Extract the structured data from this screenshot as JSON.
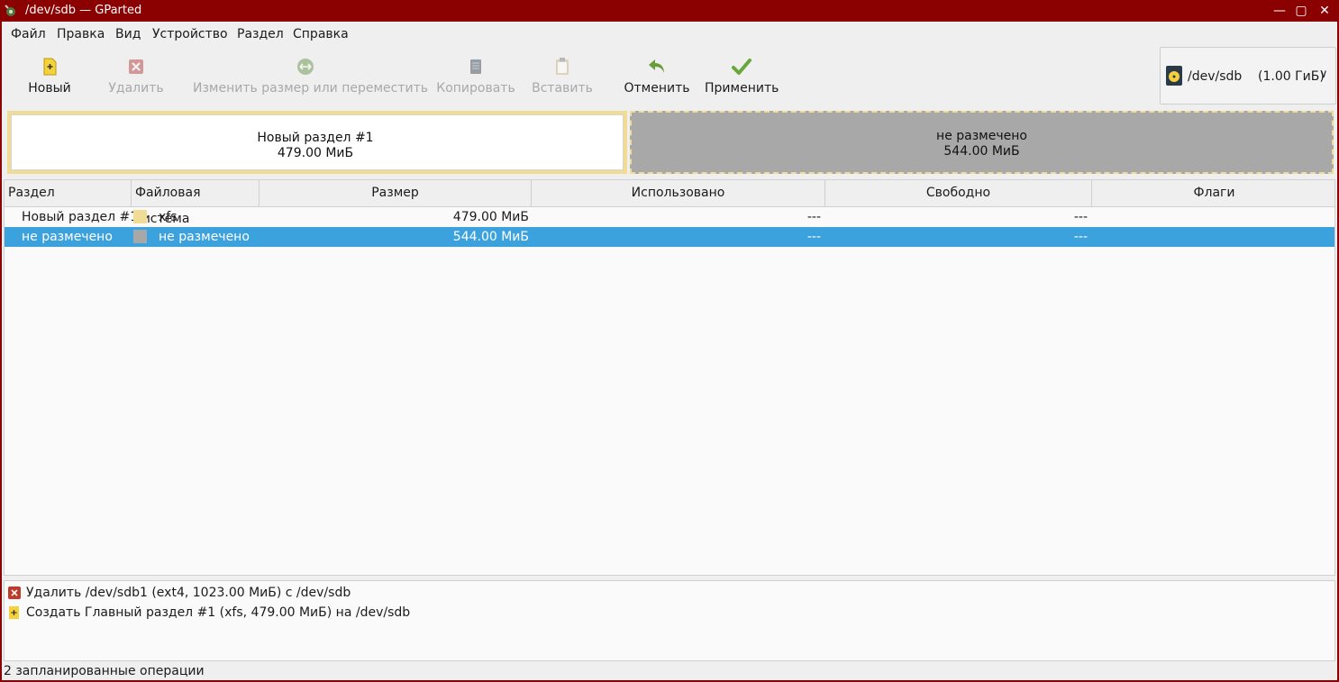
{
  "window": {
    "title": "/dev/sdb — GParted"
  },
  "menu": [
    "Файл",
    "Правка",
    "Вид",
    "Устройство",
    "Раздел",
    "Справка"
  ],
  "toolbar": {
    "new": "Новый",
    "delete": "Удалить",
    "resize": "Изменить размер или переместить",
    "copy": "Копировать",
    "paste": "Вставить",
    "undo": "Отменить",
    "apply": "Применить"
  },
  "device": {
    "name": "/dev/sdb",
    "size": "(1.00 ГиБ)"
  },
  "diskmap": {
    "used": {
      "name": "Новый раздел #1",
      "size": "479.00 МиБ"
    },
    "free": {
      "name": "не размечено",
      "size": "544.00 МиБ"
    }
  },
  "table": {
    "columns": [
      "Раздел",
      "Файловая система",
      "Размер",
      "Использовано",
      "Свободно",
      "Флаги"
    ],
    "rows": [
      {
        "partition": "Новый раздел #1",
        "fs": "xfs",
        "fs_color": "#f1dc95",
        "size": "479.00 МиБ",
        "used": "---",
        "free": "---",
        "flags": ""
      },
      {
        "partition": "не размечено",
        "fs": "не размечено",
        "fs_color": "#a8a8a8",
        "size": "544.00 МиБ",
        "used": "---",
        "free": "---",
        "flags": ""
      }
    ]
  },
  "operations": [
    {
      "icon": "delete-icon",
      "text": "Удалить /dev/sdb1 (ext4, 1023.00 МиБ) с /dev/sdb"
    },
    {
      "icon": "new-partition-icon",
      "text": "Создать Главный раздел #1 (xfs, 479.00 МиБ) на /dev/sdb"
    }
  ],
  "status": "2 запланированные операции",
  "colors": {
    "titlebar": "#8b0000",
    "selection": "#3ca2de",
    "xfs": "#f1dc95",
    "unallocated": "#a8a8a8"
  }
}
